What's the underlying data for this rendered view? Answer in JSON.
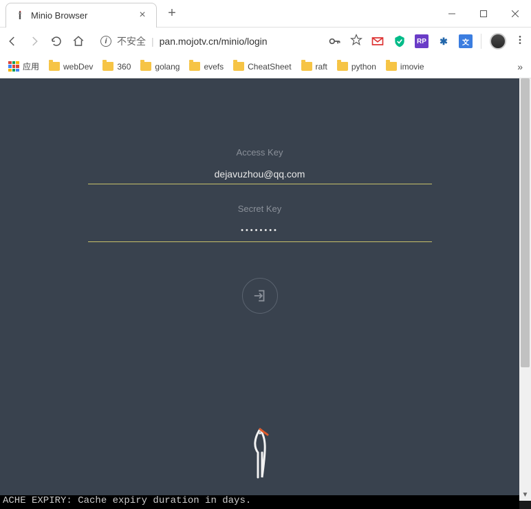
{
  "window": {
    "tab_title": "Minio Browser",
    "new_tab_symbol": "+"
  },
  "address_bar": {
    "security_text": "不安全",
    "url": "pan.mojotv.cn/minio/login"
  },
  "bookmarks_bar": {
    "apps_label": "应用",
    "items": [
      "webDev",
      "360",
      "golang",
      "evefs",
      "CheatSheet",
      "raft",
      "python",
      "imovie"
    ],
    "overflow_symbol": "»"
  },
  "login": {
    "access_key_label": "Access Key",
    "access_key_value": "dejavuzhou@qq.com",
    "secret_key_label": "Secret Key",
    "secret_key_mask": "••••••••"
  },
  "terminal_fragment": "ACHE EXPIRY: Cache expiry duration in days."
}
